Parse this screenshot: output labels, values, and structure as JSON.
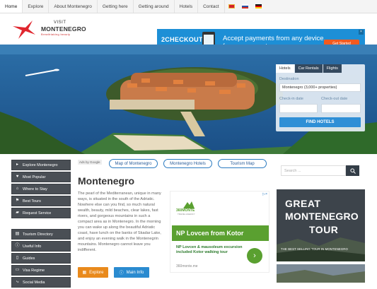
{
  "nav": {
    "items": [
      "Home",
      "Explore",
      "About Montenegro",
      "Getting here",
      "Getting around",
      "Hotels",
      "Contact"
    ],
    "flags": [
      "montenegro-flag",
      "russia-flag",
      "germany-flag"
    ]
  },
  "logo": {
    "visit": "VISIT",
    "brand": "MONTENEGRO",
    "tagline": "Breathtaking beauty"
  },
  "ad_banner": {
    "logo": "2CHECKOUT",
    "text": "Accept payments from any device, from any country.",
    "cta": "Get Started"
  },
  "booking": {
    "tabs": [
      "Hotels",
      "Car Rentals",
      "Flights"
    ],
    "destination_label": "Destination",
    "destination_value": "Montenegro (3,000+ properties)",
    "checkin_label": "Check-in date",
    "checkout_label": "Check-out date",
    "find_button": "FIND HOTELS"
  },
  "sidebar": {
    "group1": [
      "Explore Montenegro",
      "Most Popular",
      "Where to Stay",
      "Best Tours",
      "Request Service"
    ],
    "group2": [
      "Tourism Directory",
      "Useful Info",
      "Guides",
      "Visa Regime",
      "Social Media"
    ]
  },
  "main": {
    "ads_by": "Ads by Google",
    "links": [
      "Map of Montenegro",
      "Montenegro Hotels",
      "Tourism Map"
    ],
    "title": "Montenegro",
    "body": "The pearl of the Mediterranean, unique in many ways, is situated in the south of the Adriatic. Nowhere else can you find, so much natural wealth, beauty, mild beaches, clear lakes, fast rivers, and gorgeous mountains in such a compact area as in Montenegro. In the morning you can wake up along the beautiful Adriatic coast, have lunch on the banks of Skadar Lake, and enjoy an evening walk in the Montenegrin mountains. Montenegro cannot leave you indifferent.",
    "explore_button": "Explore",
    "info_button": "Main Info"
  },
  "ad2": {
    "logo": "360MONTE",
    "logo_sub": "TRAVEL AGENCY",
    "headline": "NP Lovcen from Kotor",
    "desc": "NP Lovcen & mausoleum excursion included Kotor walking tour",
    "source": "360monte.me"
  },
  "search": {
    "placeholder": "Search ..."
  },
  "tour": {
    "line1": "GREAT",
    "line2": "MONTENEGRO",
    "line3": "TOUR",
    "caption": "THE BEST SELLING TOUR IN MONTENEGRO"
  },
  "colors": {
    "accent": "#2e8fd6",
    "sidebar": "#4a4f55",
    "explore": "#e98a1c",
    "info": "#2a8bd0",
    "ad_green": "#5aa030"
  }
}
